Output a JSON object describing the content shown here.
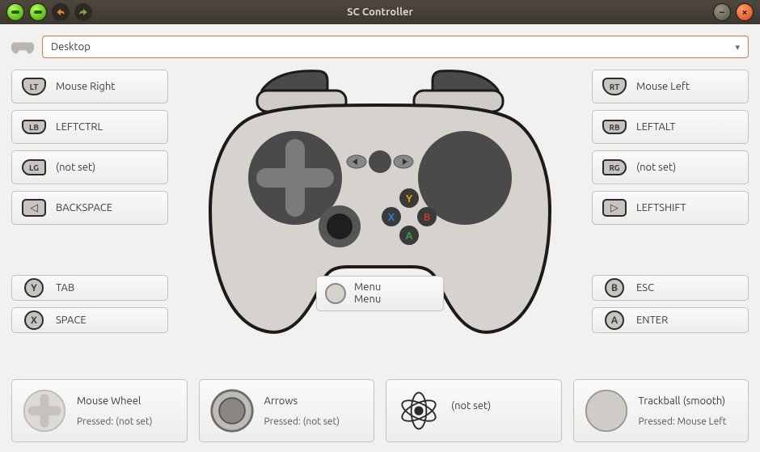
{
  "window": {
    "title": "SC Controller"
  },
  "profile": {
    "name": "Desktop"
  },
  "left_bindings": {
    "lt": {
      "badge": "LT",
      "label": "Mouse Right"
    },
    "lb": {
      "badge": "LB",
      "label": "LEFTCTRL"
    },
    "lg": {
      "badge": "LG",
      "label": "(not set)"
    },
    "back": {
      "badge": "◁",
      "label": "BACKSPACE"
    },
    "y": {
      "badge": "Y",
      "label": "TAB"
    },
    "x": {
      "badge": "X",
      "label": "SPACE"
    }
  },
  "right_bindings": {
    "rt": {
      "badge": "RT",
      "label": "Mouse Left"
    },
    "rb": {
      "badge": "RB",
      "label": "LEFTALT"
    },
    "rg": {
      "badge": "RG",
      "label": "(not set)"
    },
    "start": {
      "badge": "▷",
      "label": "LEFTSHIFT"
    },
    "b": {
      "badge": "B",
      "label": "ESC"
    },
    "a": {
      "badge": "A",
      "label": "ENTER"
    }
  },
  "center": {
    "line1": "Menu",
    "line2": "Menu"
  },
  "bottom": {
    "left_pad": {
      "label": "Mouse Wheel",
      "sub": "Pressed: (not set)"
    },
    "stick": {
      "label": "Arrows",
      "sub": "Pressed: (not set)"
    },
    "gyro": {
      "label": "(not set)",
      "sub": ""
    },
    "right_pad": {
      "label": "Trackball (smooth)",
      "sub": "Pressed: Mouse Left"
    }
  }
}
